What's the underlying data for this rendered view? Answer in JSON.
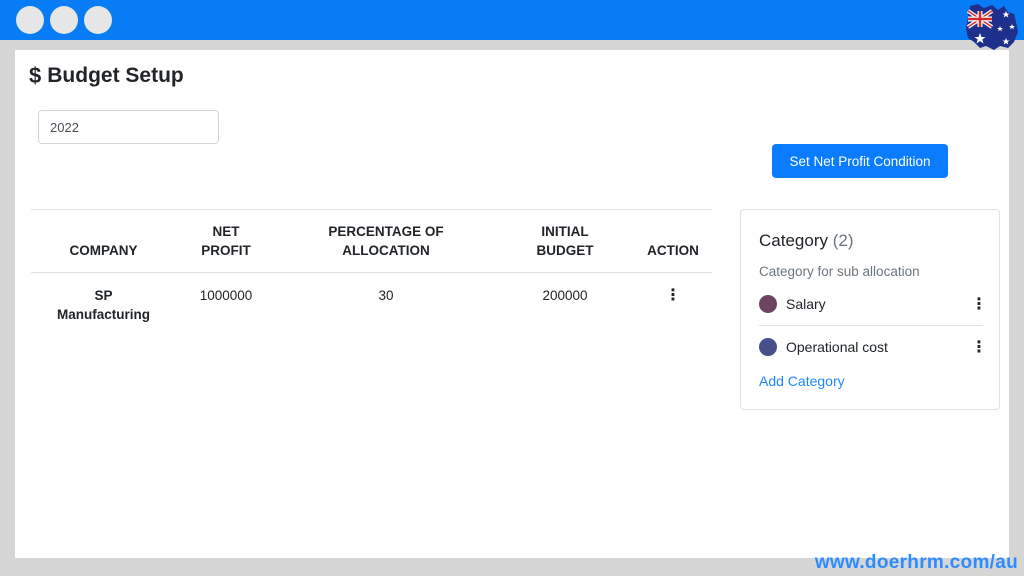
{
  "page": {
    "title": "Budget Setup",
    "title_icon": "dollar-icon",
    "year_value": "2022",
    "set_condition_label": "Set Net Profit Condition"
  },
  "table": {
    "headers": [
      "COMPANY",
      "NET PROFIT",
      "PERCENTAGE OF ALLOCATION",
      "INITIAL BUDGET",
      "ACTION"
    ],
    "rows": [
      {
        "company": "SP Manufacturing",
        "net_profit": "1000000",
        "percentage": "30",
        "initial_budget": "200000",
        "action_icon": "more-vertical-icon"
      }
    ]
  },
  "category": {
    "title": "Category",
    "count": "(2)",
    "subtitle": "Category for sub allocation",
    "items": [
      {
        "label": "Salary",
        "color": "#6e4560"
      },
      {
        "label": "Operational cost",
        "color": "#47508a"
      }
    ],
    "add_label": "Add Category"
  },
  "colors": {
    "topbar": "#087cf4",
    "primary_button": "#0a7cff",
    "link": "#1e88ff"
  },
  "watermark": "www.doerhrm.com/au"
}
